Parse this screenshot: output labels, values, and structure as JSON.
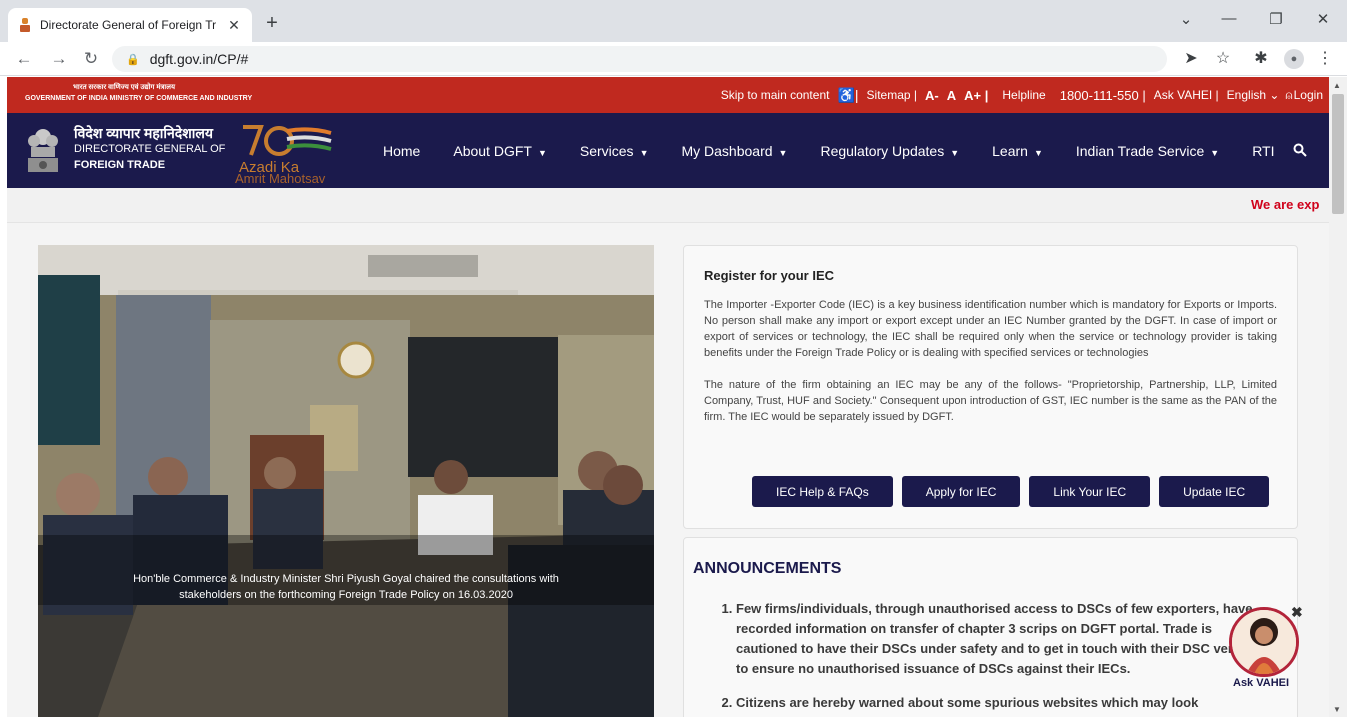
{
  "browser": {
    "tab_title": "Directorate General of Foreign Tr",
    "tab_close": "✕",
    "new_tab": "+",
    "address": "dgft.gov.in/CP/#",
    "window_controls": [
      "⌄",
      "—",
      "❐",
      "✕"
    ]
  },
  "topbar": {
    "gov_hindi": "भारत सरकार   वाणिज्य एवं उद्योग मंत्रालय",
    "gov_english": "GOVERNMENT OF INDIA   MINISTRY OF COMMERCE AND INDUSTRY",
    "skip": "Skip to main content",
    "sitemap": "Sitemap |",
    "font_small": "A-",
    "font_normal": "A",
    "font_large": "A+ |",
    "helpline_label": "Helpline",
    "helpline_number": "1800-111-550 |",
    "ask_vahei": "Ask VAHEI |",
    "language": "English ⌄",
    "login": "Login"
  },
  "brand": {
    "hindi": "विदेश व्यापार महानिदेशालय",
    "line1": "DIRECTORATE GENERAL OF",
    "line2": "FOREIGN TRADE",
    "azadi_1": "Azadi Ka",
    "azadi_2": "Amrit Mahotsav"
  },
  "menu": [
    {
      "label": "Home",
      "dropdown": false
    },
    {
      "label": "About DGFT",
      "dropdown": true
    },
    {
      "label": "Services",
      "dropdown": true
    },
    {
      "label": "My Dashboard",
      "dropdown": true
    },
    {
      "label": "Regulatory Updates",
      "dropdown": true
    },
    {
      "label": "Learn",
      "dropdown": true
    },
    {
      "label": "Indian Trade Service",
      "dropdown": true
    },
    {
      "label": "RTI",
      "dropdown": false
    }
  ],
  "marquee": "We are exp",
  "hero": {
    "caption_line1": "Hon'ble Commerce & Industry Minister Shri Piyush Goyal chaired the consultations with",
    "caption_line2": "stakeholders on the forthcoming Foreign Trade Policy on 16.03.2020"
  },
  "iec": {
    "heading": "Register for your IEC",
    "para1": "The Importer -Exporter Code (IEC) is a key business identification number which is mandatory for Exports or Imports. No person shall make any import or export except under an IEC Number granted by the DGFT. In case of import or export of services or technology, the IEC shall be required only when the service or technology provider is taking benefits under the Foreign Trade Policy or is dealing with specified services or technologies",
    "para2": "The nature of the firm obtaining an IEC may be any of the follows- \"Proprietorship, Partnership, LLP, Limited Company, Trust, HUF and Society.\" Consequent upon introduction of GST, IEC number is the same as the PAN of the firm. The IEC would be separately issued by DGFT.",
    "buttons": [
      "IEC Help & FAQs",
      "Apply for IEC",
      "Link Your IEC",
      "Update IEC"
    ]
  },
  "announcements": {
    "heading": "ANNOUNCEMENTS",
    "items": [
      "Few firms/individuals, through unauthorised access to DSCs of few exporters, have recorded information on transfer of chapter 3 scrips on DGFT portal. Trade is cautioned to have their DSCs under safety and to get in touch with their DSC vendor to ensure no unauthorised issuance of DSCs against their IECs.",
      "Citizens are hereby warned about some spurious websites which may look"
    ]
  },
  "vahei_widget": {
    "label": "Ask VAHEI",
    "close": "✖"
  },
  "colors": {
    "topbar": "#c0291f",
    "navbar": "#1b1a4c",
    "button": "#1b1a4c",
    "marquee": "#d0021b"
  }
}
